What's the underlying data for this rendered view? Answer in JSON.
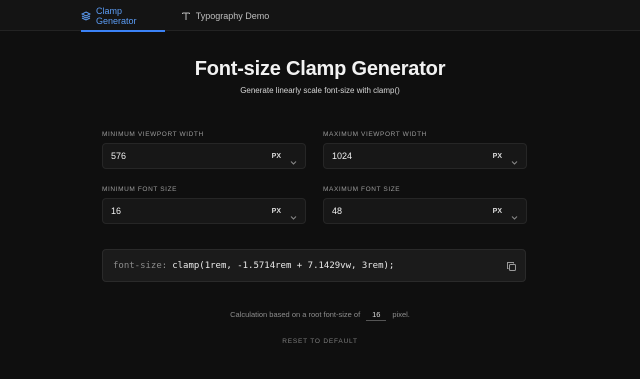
{
  "nav": {
    "tabs": [
      {
        "label": "Clamp Generator",
        "icon": "layers-icon",
        "active": true
      },
      {
        "label": "Typography Demo",
        "icon": "text-icon",
        "active": false
      }
    ]
  },
  "header": {
    "title": "Font-size Clamp Generator",
    "subtitle": "Generate linearly scale font-size with clamp()"
  },
  "fields": {
    "min_viewport": {
      "label": "MINIMUM VIEWPORT WIDTH",
      "value": "576",
      "unit": "PX"
    },
    "max_viewport": {
      "label": "MAXIMUM VIEWPORT WIDTH",
      "value": "1024",
      "unit": "PX"
    },
    "min_font": {
      "label": "MINIMUM FONT SIZE",
      "value": "16",
      "unit": "PX"
    },
    "max_font": {
      "label": "MAXIMUM FONT SIZE",
      "value": "48",
      "unit": "PX"
    }
  },
  "output": {
    "property": "font-size:",
    "value": "clamp(1rem, -1.5714rem + 7.1429vw, 3rem);"
  },
  "calc": {
    "prefix": "Calculation based on a root font-size of",
    "root_value": "16",
    "suffix": "pixel."
  },
  "reset_label": "RESET TO DEFAULT",
  "colors": {
    "accent": "#3b82f6",
    "background": "#0f0f0f",
    "field_bg": "#171717"
  }
}
